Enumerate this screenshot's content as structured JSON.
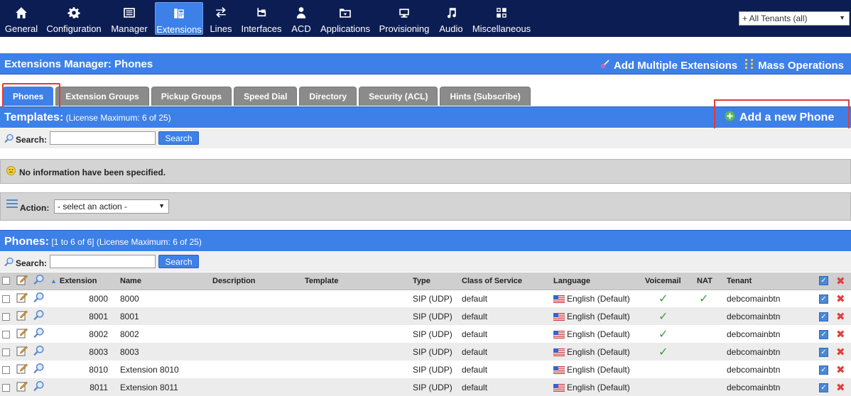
{
  "nav": {
    "items": [
      {
        "label": "General",
        "icon": "home-icon"
      },
      {
        "label": "Configuration",
        "icon": "gear-icon"
      },
      {
        "label": "Manager",
        "icon": "manager-icon"
      },
      {
        "label": "Extensions",
        "icon": "phone-icon",
        "active": true
      },
      {
        "label": "Lines",
        "icon": "lines-icon"
      },
      {
        "label": "Interfaces",
        "icon": "interfaces-icon"
      },
      {
        "label": "ACD",
        "icon": "agent-icon"
      },
      {
        "label": "Applications",
        "icon": "applications-icon"
      },
      {
        "label": "Provisioning",
        "icon": "provisioning-icon"
      },
      {
        "label": "Audio",
        "icon": "music-note-icon"
      },
      {
        "label": "Miscellaneous",
        "icon": "grid-icon"
      }
    ],
    "tenant_select": "+ All Tenants (all)"
  },
  "manager": {
    "title": "Extensions Manager:  Phones",
    "add_multiple": "Add Multiple Extensions",
    "mass_operations": "Mass Operations"
  },
  "tabs": [
    "Phones",
    "Extension Groups",
    "Pickup Groups",
    "Speed Dial",
    "Directory",
    "Security (ACL)",
    "Hints (Subscribe)"
  ],
  "templates": {
    "title": "Templates:",
    "license": "(License Maximum: 6 of 25)",
    "add_phone": "Add a new Phone",
    "search_label": "Search:",
    "search_button": "Search",
    "search_value": "",
    "info": "No information have been specified.",
    "action_label": "Action:",
    "action_select": "- select an action -"
  },
  "phones": {
    "title": "Phones:",
    "range": "[1 to 6 of 6]",
    "license": "(License Maximum: 6 of 25)",
    "search_label": "Search:",
    "search_button": "Search",
    "search_value": "",
    "columns": {
      "extension": "Extension",
      "name": "Name",
      "description": "Description",
      "template": "Template",
      "type": "Type",
      "class_of_service": "Class of Service",
      "language": "Language",
      "voicemail": "Voicemail",
      "nat": "NAT",
      "tenant": "Tenant"
    },
    "rows": [
      {
        "extension": "8000",
        "name": "8000",
        "description": "",
        "template": "",
        "type": "SIP (UDP)",
        "cos": "default",
        "language": "English (Default)",
        "voicemail": true,
        "nat": true,
        "tenant": "debcomainbtn"
      },
      {
        "extension": "8001",
        "name": "8001",
        "description": "",
        "template": "",
        "type": "SIP (UDP)",
        "cos": "default",
        "language": "English (Default)",
        "voicemail": true,
        "nat": false,
        "tenant": "debcomainbtn"
      },
      {
        "extension": "8002",
        "name": "8002",
        "description": "",
        "template": "",
        "type": "SIP (UDP)",
        "cos": "default",
        "language": "English (Default)",
        "voicemail": true,
        "nat": false,
        "tenant": "debcomainbtn"
      },
      {
        "extension": "8003",
        "name": "8003",
        "description": "",
        "template": "",
        "type": "SIP (UDP)",
        "cos": "default",
        "language": "English (Default)",
        "voicemail": true,
        "nat": false,
        "tenant": "debcomainbtn"
      },
      {
        "extension": "8010",
        "name": "Extension 8010",
        "description": "",
        "template": "",
        "type": "SIP (UDP)",
        "cos": "default",
        "language": "English (Default)",
        "voicemail": false,
        "nat": false,
        "tenant": "debcomainbtn"
      },
      {
        "extension": "8011",
        "name": "Extension 8011",
        "description": "",
        "template": "",
        "type": "SIP (UDP)",
        "cos": "default",
        "language": "English (Default)",
        "voicemail": false,
        "nat": false,
        "tenant": "debcomainbtn"
      }
    ]
  },
  "colors": {
    "nav_bg": "#0c1d54",
    "accent": "#3d80e8",
    "highlight_ring": "#e23b3b",
    "check_green": "#3f9a3f"
  }
}
